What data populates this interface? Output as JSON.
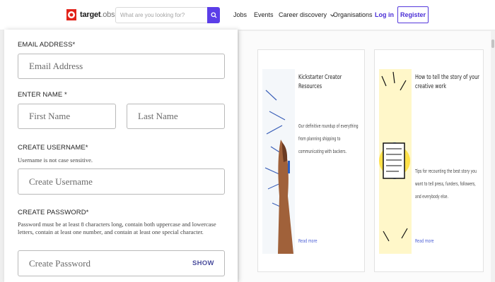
{
  "header": {
    "logo_text": "target",
    "logo_suffix": ".obs",
    "search_placeholder": "What are you looking for?",
    "nav": {
      "jobs": "Jobs",
      "events": "Events",
      "career_discovery": "Career discovery",
      "organisations": "Organisations",
      "login": "Log in",
      "register": "Register"
    }
  },
  "form": {
    "email_label": "EMAIL ADDRESS*",
    "email_placeholder": "Email Address",
    "name_label": "ENTER NAME *",
    "first_name_placeholder": "First Name",
    "last_name_placeholder": "Last Name",
    "username_label": "CREATE USERNAME*",
    "username_hint": "Username is not case sensitive.",
    "username_placeholder": "Create Username",
    "password_label": "CREATE PASSWORD*",
    "password_hint": "Password must be at least 8 characters long, contain both uppercase and lowercase letters, contain at least one number, and contain at least one special character.",
    "password_placeholder": "Create Password",
    "show_label": "SHOW"
  },
  "cards": [
    {
      "title": "Kickstarter Creator Resources",
      "description": "Our definitive roundup of everything from planning shipping to communicating with backers.",
      "link": "Read more"
    },
    {
      "title": "How to tell the story of your creative work",
      "description": "Tips for recounting the best story you want to tell press, funders, followers, and everybody else.",
      "link": "Read more"
    }
  ],
  "colors": {
    "accent": "#5b3ee8",
    "brand_red": "#e2231a",
    "link": "#4b2fd6"
  },
  "icons": {
    "search": "magnifier",
    "dropdown": "chevron-down"
  }
}
